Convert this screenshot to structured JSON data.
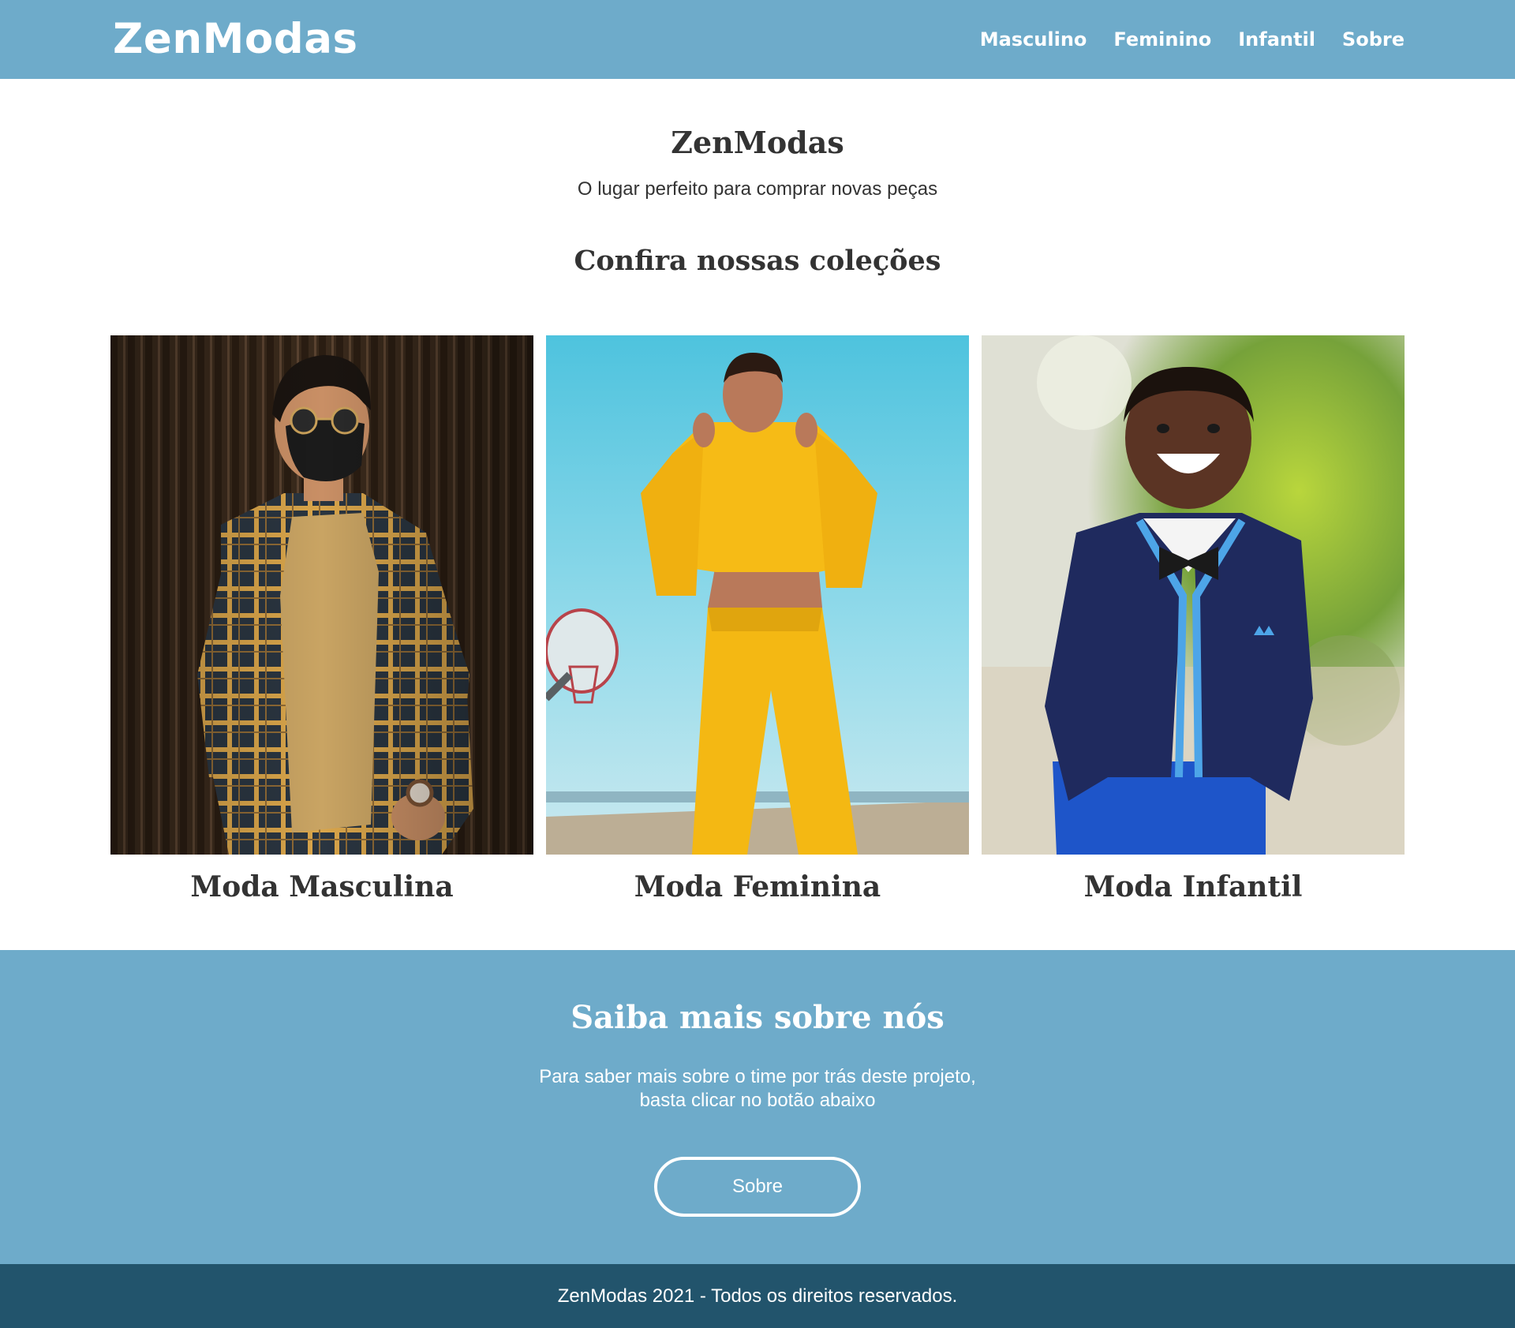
{
  "header": {
    "logo": "ZenModas",
    "nav": [
      "Masculino",
      "Feminino",
      "Infantil",
      "Sobre"
    ]
  },
  "intro": {
    "title": "ZenModas",
    "subtitle": "O lugar perfeito para comprar novas peças",
    "collections_title": "Confira nossas coleções"
  },
  "collections": [
    {
      "title": "Moda Masculina",
      "image": "photo-man-plaid-shirt-sunglasses-mask"
    },
    {
      "title": "Moda Feminina",
      "image": "photo-woman-yellow-tracksuit"
    },
    {
      "title": "Moda Infantil",
      "image": "photo-boy-navy-cardigan-bowtie"
    }
  ],
  "about": {
    "title": "Saiba mais sobre nós",
    "text_line1": "Para saber mais sobre o time por trás deste projeto,",
    "text_line2": "basta clicar no botão abaixo",
    "button": "Sobre"
  },
  "footer": {
    "text": "ZenModas 2021 - Todos os direitos reservados."
  },
  "colors": {
    "header_bg": "#6eabca",
    "about_bg": "#6eabca",
    "footer_bg": "#22546c",
    "text": "#333333"
  }
}
